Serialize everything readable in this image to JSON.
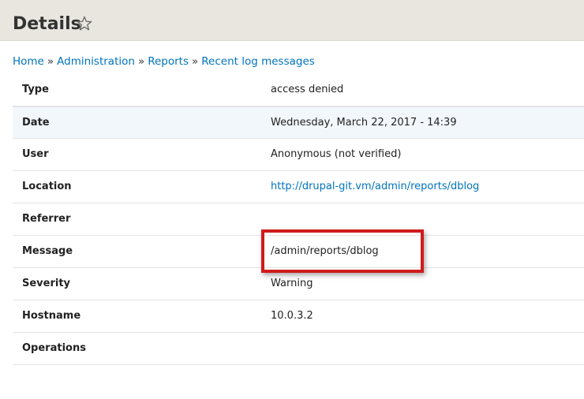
{
  "page": {
    "title": "Details",
    "favorite_icon": "star-outline-icon"
  },
  "breadcrumb": {
    "items": [
      "Home",
      "Administration",
      "Reports",
      "Recent log messages"
    ],
    "separator": "»"
  },
  "details": {
    "rows": [
      {
        "label": "Type",
        "value": "access denied"
      },
      {
        "label": "Date",
        "value": "Wednesday, March 22, 2017 - 14:39"
      },
      {
        "label": "User",
        "value": "Anonymous (not verified)"
      },
      {
        "label": "Location",
        "value": "http://drupal-git.vm/admin/reports/dblog"
      },
      {
        "label": "Referrer",
        "value": ""
      },
      {
        "label": "Message",
        "value": "/admin/reports/dblog"
      },
      {
        "label": "Severity",
        "value": "Warning"
      },
      {
        "label": "Hostname",
        "value": "10.0.3.2"
      },
      {
        "label": "Operations",
        "value": ""
      }
    ]
  },
  "colors": {
    "header_bg": "#e8e6df",
    "link": "#0074bd",
    "highlight_border": "#d01b1b",
    "striped_row": "#f2f7fb"
  }
}
